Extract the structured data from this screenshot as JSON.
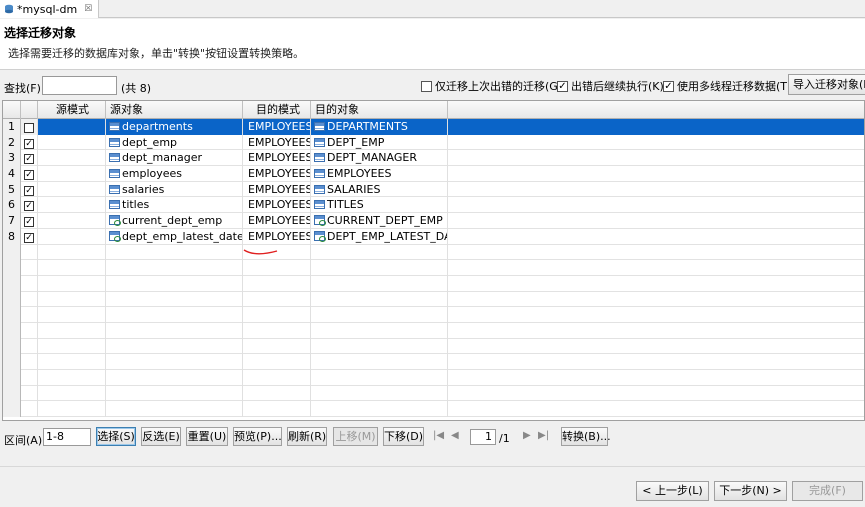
{
  "tab": {
    "title": "*mysql-dm",
    "close": "☒"
  },
  "header": {
    "title": "选择迁移对象",
    "description": "选择需要迁移的数据库对象，单击\"转换\"按钮设置转换策略。"
  },
  "toolbar": {
    "find_label": "查找(F):",
    "find_value": "",
    "count": "(共 8)",
    "options": [
      {
        "label": "仅迁移上次出错的迁移(G)",
        "checked": false
      },
      {
        "label": "出错后继续执行(K)",
        "checked": true
      },
      {
        "label": "使用多线程迁移数据(T)",
        "checked": true
      }
    ],
    "import_label": "导入迁移对象(I)"
  },
  "grid": {
    "headers": [
      "源模式",
      "源对象",
      "目的模式",
      "目的对象"
    ],
    "rows": [
      {
        "num": "1",
        "checked": true,
        "src_schema": "",
        "src_obj": "departments",
        "dst_schema": "EMPLOYEES",
        "dst_obj": "DEPARTMENTS",
        "icon": "table-icon",
        "selected": true
      },
      {
        "num": "2",
        "checked": true,
        "src_schema": "",
        "src_obj": "dept_emp",
        "dst_schema": "EMPLOYEES",
        "dst_obj": "DEPT_EMP",
        "icon": "table-icon",
        "selected": false
      },
      {
        "num": "3",
        "checked": true,
        "src_schema": "",
        "src_obj": "dept_manager",
        "dst_schema": "EMPLOYEES",
        "dst_obj": "DEPT_MANAGER",
        "icon": "table-icon",
        "selected": false
      },
      {
        "num": "4",
        "checked": true,
        "src_schema": "",
        "src_obj": "employees",
        "dst_schema": "EMPLOYEES",
        "dst_obj": "EMPLOYEES",
        "icon": "table-icon",
        "selected": false
      },
      {
        "num": "5",
        "checked": true,
        "src_schema": "",
        "src_obj": "salaries",
        "dst_schema": "EMPLOYEES",
        "dst_obj": "SALARIES",
        "icon": "table-icon",
        "selected": false
      },
      {
        "num": "6",
        "checked": true,
        "src_schema": "",
        "src_obj": "titles",
        "dst_schema": "EMPLOYEES",
        "dst_obj": "TITLES",
        "icon": "table-icon",
        "selected": false
      },
      {
        "num": "7",
        "checked": true,
        "src_schema": "",
        "src_obj": "current_dept_emp",
        "dst_schema": "EMPLOYEES",
        "dst_obj": "CURRENT_DEPT_EMP",
        "icon": "view-icon",
        "selected": false
      },
      {
        "num": "8",
        "checked": true,
        "src_schema": "",
        "src_obj": "dept_emp_latest_date",
        "dst_schema": "EMPLOYEES",
        "dst_obj": "DEPT_EMP_LATEST_DAT",
        "icon": "view-icon",
        "selected": false
      }
    ],
    "empty_rows": 11
  },
  "range": {
    "label": "区间(A):",
    "value": "1-8"
  },
  "actions": {
    "select": "选择(S)",
    "invert": "反选(E)",
    "reset": "重置(U)",
    "preview": "预览(P)...",
    "refresh": "刷新(R)",
    "move_up": "上移(M)",
    "move_down": "下移(D)",
    "convert": "转换(B)..."
  },
  "pager": {
    "page": "1",
    "total": "/1"
  },
  "footer": {
    "prev": "< 上一步(L)",
    "next": "下一步(N) >",
    "finish": "完成(F)"
  },
  "colors": {
    "selection": "#0a64c8",
    "annotation": "#e02020"
  }
}
